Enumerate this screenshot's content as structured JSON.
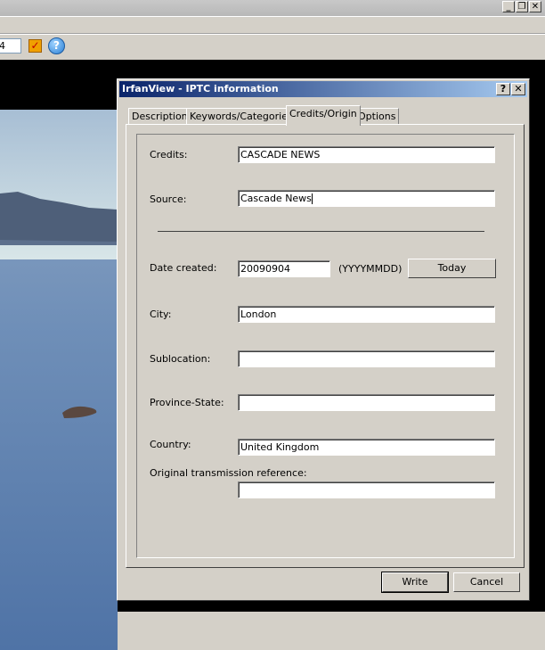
{
  "window": {
    "minimize_glyph": "_",
    "restore_glyph": "❐",
    "close_glyph": "✕"
  },
  "toolbar": {
    "zoom_value": "4",
    "check_glyph": "✓",
    "help_glyph": "?"
  },
  "dialog": {
    "title": "IrfanView - IPTC information",
    "help_glyph": "?",
    "close_glyph": "✕",
    "tabs": [
      {
        "label": "Description"
      },
      {
        "label": "Keywords/Categories"
      },
      {
        "label": "Credits/Origin"
      },
      {
        "label": "Options"
      }
    ],
    "active_tab": "Credits/Origin",
    "fields": {
      "credits": {
        "label": "Credits:",
        "value": "CASCADE NEWS"
      },
      "source": {
        "label": "Source:",
        "value": "Cascade News"
      },
      "date_created": {
        "label": "Date created:",
        "value": "20090904",
        "format_hint": "(YYYYMMDD)"
      },
      "city": {
        "label": "City:",
        "value": "London"
      },
      "sublocation": {
        "label": "Sublocation:",
        "value": ""
      },
      "province_state": {
        "label": "Province-State:",
        "value": ""
      },
      "country": {
        "label": "Country:",
        "value": "United Kingdom"
      },
      "original_transmission_reference": {
        "label": "Original transmission reference:",
        "value": ""
      }
    },
    "today_button": "Today",
    "write_button": "Write",
    "cancel_button": "Cancel"
  },
  "colors": {
    "titlebar_start": "#0a246a",
    "titlebar_end": "#a6caf0",
    "face": "#d4d0c8"
  }
}
